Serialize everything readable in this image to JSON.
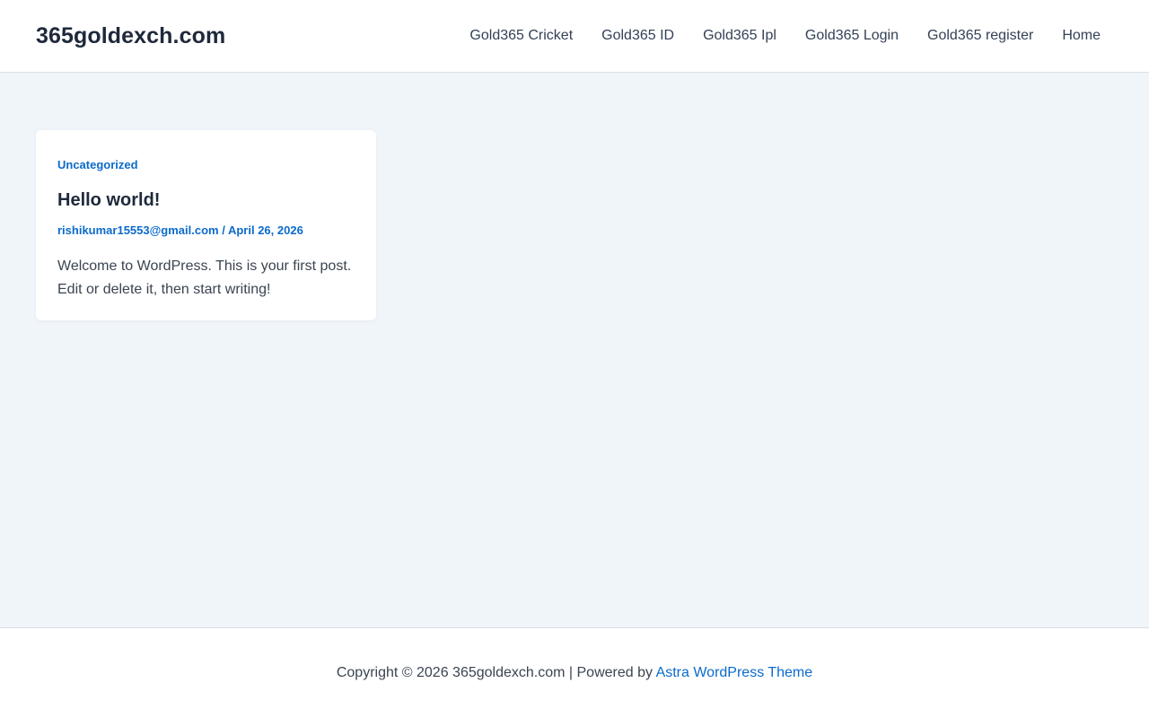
{
  "header": {
    "site_title": "365goldexch.com",
    "nav": [
      {
        "label": "Gold365 Cricket"
      },
      {
        "label": "Gold365 ID"
      },
      {
        "label": "Gold365 Ipl"
      },
      {
        "label": "Gold365 Login"
      },
      {
        "label": "Gold365 register"
      },
      {
        "label": "Home"
      }
    ]
  },
  "post": {
    "category": "Uncategorized",
    "title": "Hello world!",
    "author": "rishikumar15553@gmail.com",
    "separator": " / ",
    "date": "April 26, 2026",
    "excerpt": "Welcome to WordPress. This is your first post. Edit or delete it, then start writing!"
  },
  "footer": {
    "copyright": "Copyright © 2026 365goldexch.com | Powered by ",
    "theme_link": "Astra WordPress Theme"
  },
  "colors": {
    "accent": "#0b6bcb",
    "page_background": "#f0f5fa",
    "heading": "#1e293b"
  }
}
